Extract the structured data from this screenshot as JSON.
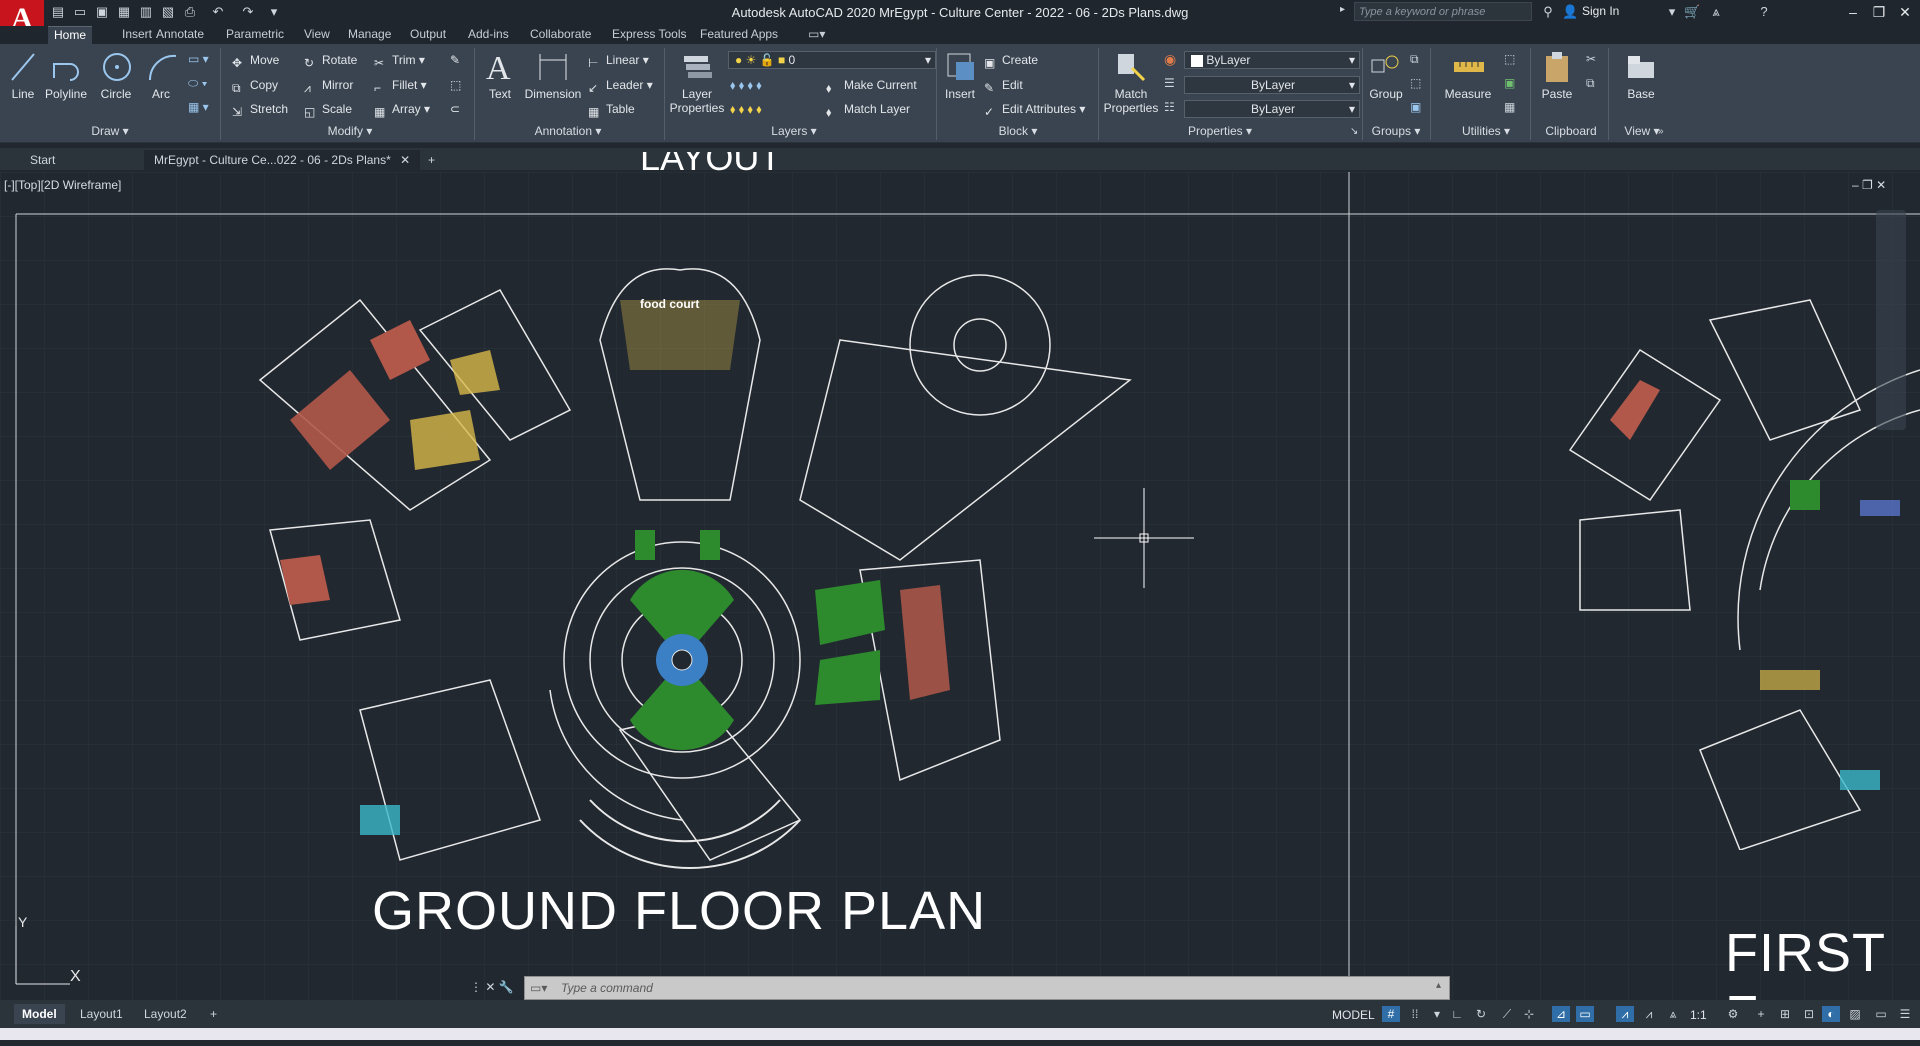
{
  "app": {
    "logo_letter": "A",
    "title": "Autodesk AutoCAD 2020    MrEgypt - Culture Center - 2022 - 06 - 2Ds Plans.dwg",
    "search_placeholder": "Type a keyword or phrase",
    "sign_in": "Sign In"
  },
  "ribbon_tabs": [
    "Home",
    "Insert",
    "Annotate",
    "Parametric",
    "View",
    "Manage",
    "Output",
    "Add-ins",
    "Collaborate",
    "Express Tools",
    "Featured Apps"
  ],
  "active_tab": "Home",
  "draw": {
    "line": "Line",
    "polyline": "Polyline",
    "circle": "Circle",
    "arc": "Arc",
    "panel": "Draw"
  },
  "modify": {
    "move": "Move",
    "rotate": "Rotate",
    "trim": "Trim",
    "copy": "Copy",
    "mirror": "Mirror",
    "fillet": "Fillet",
    "stretch": "Stretch",
    "scale": "Scale",
    "array": "Array",
    "panel": "Modify"
  },
  "annotation": {
    "text": "Text",
    "dimension": "Dimension",
    "linear": "Linear",
    "leader": "Leader",
    "table": "Table",
    "panel": "Annotation"
  },
  "layers": {
    "layer_properties_1": "Layer",
    "layer_properties_2": "Properties",
    "current_layer": "0",
    "make_current": "Make Current",
    "match_layer": "Match Layer",
    "panel": "Layers"
  },
  "block": {
    "insert": "Insert",
    "create": "Create",
    "edit": "Edit",
    "edit_attributes": "Edit Attributes",
    "panel": "Block"
  },
  "properties": {
    "match_1": "Match",
    "match_2": "Properties",
    "color": "ByLayer",
    "linetype": "ByLayer",
    "lineweight": "ByLayer",
    "panel": "Properties"
  },
  "groups": {
    "group": "Group",
    "panel": "Groups"
  },
  "utilities": {
    "measure": "Measure",
    "panel": "Utilities"
  },
  "clipboard": {
    "paste": "Paste",
    "panel": "Clipboard"
  },
  "view": {
    "base": "Base",
    "panel": "View"
  },
  "file_tabs": {
    "start": "Start",
    "doc": "MrEgypt - Culture Ce...022 - 06 - 2Ds Plans*"
  },
  "viewport_label": "[-][Top][2D Wireframe]",
  "drawing": {
    "title_main": "GROUND FLOOR PLAN",
    "title_second": "FIRST F",
    "title_top_partial": "LAYOUT",
    "food_court_label": "food court",
    "ucs_x": "X",
    "ucs_y": "Y"
  },
  "command_placeholder": "Type a command",
  "layout_tabs": [
    "Model",
    "Layout1",
    "Layout2"
  ],
  "status": {
    "model": "MODEL",
    "scale": "1:1"
  },
  "colors": {
    "background": "#212830",
    "ribbon": "#3a4450",
    "accent": "#2f6ea6",
    "brand_red": "#c8151d",
    "plan_red": "#b2584a",
    "plan_green": "#2d8a2d",
    "plan_yellow": "#d8b84a",
    "plan_blue": "#3b7fc4"
  }
}
